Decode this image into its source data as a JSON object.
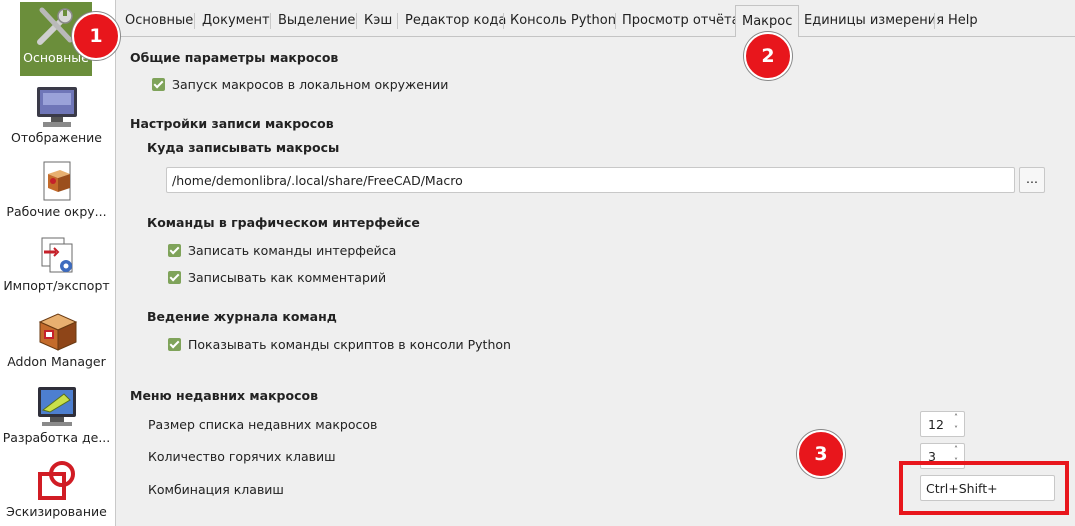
{
  "sidebar": {
    "items": [
      {
        "label": "Основные",
        "icon": "tools-icon",
        "selected": true
      },
      {
        "label": "Отображение",
        "icon": "monitor-icon"
      },
      {
        "label": "Рабочие окру...",
        "icon": "workbench-box-icon"
      },
      {
        "label": "Импорт/экспорт",
        "icon": "import-export-icon"
      },
      {
        "label": "Addon Manager",
        "icon": "addon-box-icon"
      },
      {
        "label": "Разработка де...",
        "icon": "part-design-icon"
      },
      {
        "label": "Эскизирование",
        "icon": "sketcher-icon"
      }
    ]
  },
  "tabs": [
    {
      "label": "Основные"
    },
    {
      "label": "Документ"
    },
    {
      "label": "Выделение"
    },
    {
      "label": "Кэш"
    },
    {
      "label": "Редактор кода"
    },
    {
      "label": "Консоль Python"
    },
    {
      "label": "Просмотр отчёта"
    },
    {
      "label": "Макрос",
      "active": true
    },
    {
      "label": "Единицы измерения"
    },
    {
      "label": "Help"
    }
  ],
  "general": {
    "heading": "Общие параметры макросов",
    "run_local": "Запуск макросов в локальном окружении"
  },
  "recording": {
    "heading": "Настройки записи макросов",
    "path_heading": "Куда записывать макросы",
    "path_value": "/home/demonlibra/.local/share/FreeCAD/Macro",
    "browse_label": "...",
    "gui_heading": "Команды в графическом интерфейсе",
    "record_gui": "Записать команды интерфейса",
    "record_as_comment": "Записывать как комментарий",
    "log_heading": "Ведение журнала команд",
    "show_script_commands": "Показывать команды скриптов в консоли Python"
  },
  "recent": {
    "heading": "Меню недавних макросов",
    "size_label": "Размер списка недавних макросов",
    "size_value": "12",
    "hotkeys_label": "Количество горячих клавиш",
    "hotkeys_value": "3",
    "shortcut_label": "Комбинация клавиш",
    "shortcut_value": "Ctrl+Shift+"
  },
  "badges": [
    "1",
    "2",
    "3"
  ],
  "colors": {
    "accent": "#6b8e3b",
    "checkbox": "#7fa35a",
    "annotation_red": "#e8161c"
  }
}
